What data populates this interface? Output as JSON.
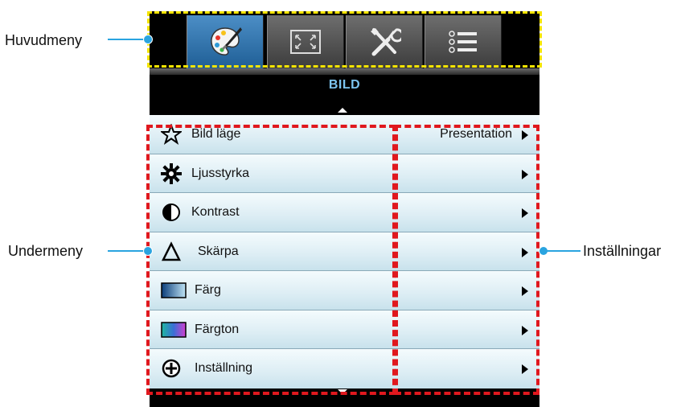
{
  "callouts": {
    "main_menu": "Huvudmeny",
    "sub_menu": "Undermeny",
    "settings": "Inställningar"
  },
  "header": {
    "title": "BILD"
  },
  "tabs": [
    {
      "icon": "palette-icon",
      "active": true
    },
    {
      "icon": "screen-resize-icon",
      "active": false
    },
    {
      "icon": "tools-icon",
      "active": false
    },
    {
      "icon": "list-menu-icon",
      "active": false
    }
  ],
  "rows": [
    {
      "icon": "star-icon",
      "label": "Bild läge",
      "value": "Presentation"
    },
    {
      "icon": "brightness-icon",
      "label": "Ljusstyrka",
      "value": ""
    },
    {
      "icon": "contrast-icon",
      "label": "Kontrast",
      "value": ""
    },
    {
      "icon": "sharpness-icon",
      "label": "Skärpa",
      "value": ""
    },
    {
      "icon": "color-icon",
      "label": "Färg",
      "value": ""
    },
    {
      "icon": "tint-icon",
      "label": "Färgton",
      "value": ""
    },
    {
      "icon": "settings-plus-icon",
      "label": "Inställning",
      "value": ""
    }
  ],
  "colors": {
    "highlight_dash_yellow": "#f5e400",
    "highlight_dash_red": "#e0181e",
    "callout_blue": "#2aa4e0",
    "title_blue": "#7cc4f0"
  }
}
